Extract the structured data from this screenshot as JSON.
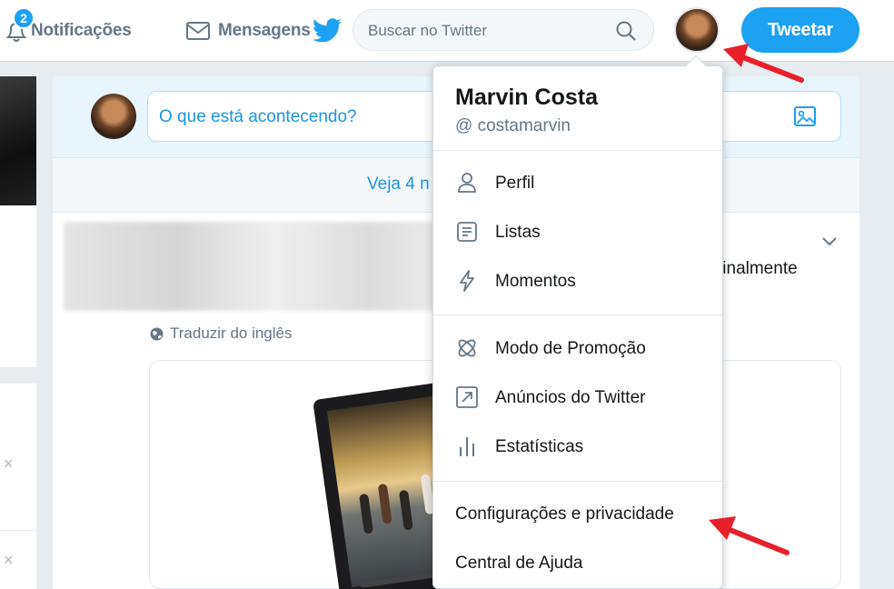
{
  "topbar": {
    "notifications": {
      "label": "Notificações",
      "badge": "2"
    },
    "messages": {
      "label": "Mensagens"
    },
    "search": {
      "placeholder": "Buscar no Twitter",
      "value": ""
    },
    "tweet_button": "Tweetar"
  },
  "profile_menu": {
    "name": "Marvin Costa",
    "handle": "@ costamarvin",
    "section_1": [
      {
        "label": "Perfil",
        "icon": "person-icon"
      },
      {
        "label": "Listas",
        "icon": "list-icon"
      },
      {
        "label": "Momentos",
        "icon": "lightning-icon"
      }
    ],
    "section_2": [
      {
        "label": "Modo de Promoção",
        "icon": "promote-icon"
      },
      {
        "label": "Anúncios do Twitter",
        "icon": "arrow-up-right-icon"
      },
      {
        "label": "Estatísticas",
        "icon": "bar-chart-icon"
      }
    ],
    "section_3": [
      {
        "label": "Configurações e privacidade"
      },
      {
        "label": "Central de Ajuda"
      }
    ]
  },
  "timeline": {
    "composer_placeholder": "O que está acontecendo?",
    "new_tweets_text": "Veja 4 n",
    "tweet_text_tail": "finalmente",
    "translate_label": "Traduzir do inglês"
  },
  "sidebar": {
    "close_symbols": [
      "×",
      "×"
    ]
  },
  "colors": {
    "accent": "#1da1f2",
    "link": "#1b95e0",
    "annotation_arrow": "#e8202a"
  }
}
